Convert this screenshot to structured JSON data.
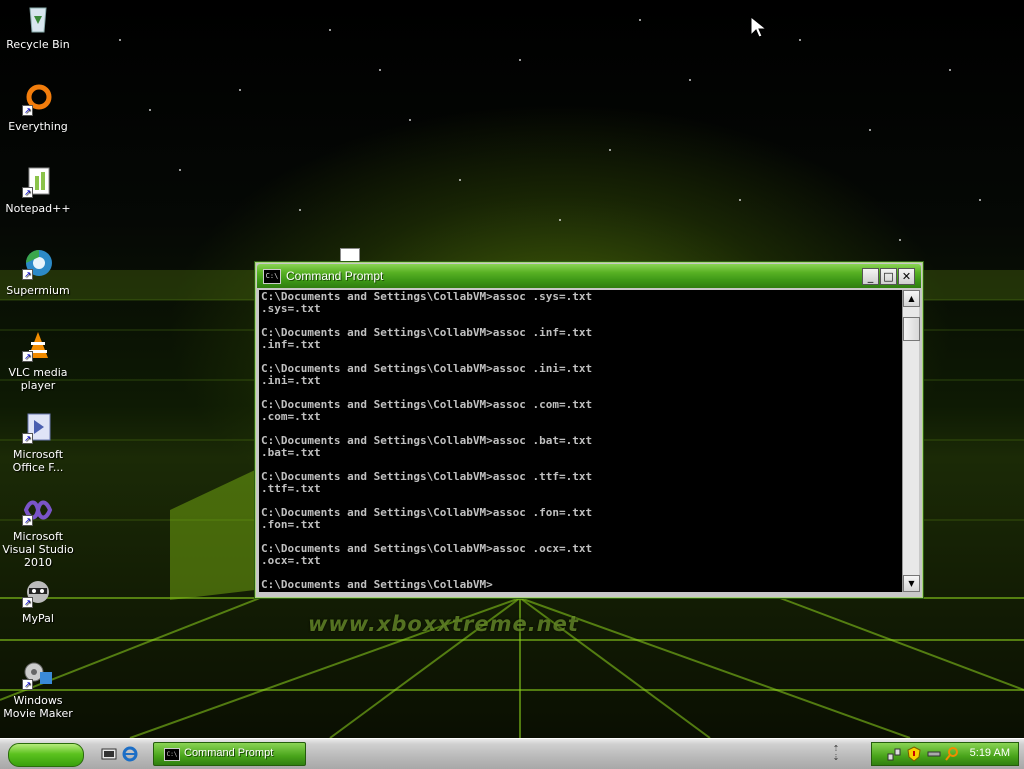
{
  "desktop": {
    "watermark": "www.xboxxtreme.net",
    "icons": [
      {
        "label": "Recycle Bin"
      },
      {
        "label": "Everything"
      },
      {
        "label": "Notepad++"
      },
      {
        "label": "Supermium"
      },
      {
        "label": "VLC media player"
      },
      {
        "label": "Microsoft Office F..."
      },
      {
        "label": "Microsoft Visual Studio 2010"
      },
      {
        "label": "MyPal"
      },
      {
        "label": "Windows Movie Maker"
      }
    ]
  },
  "window": {
    "title": "Command Prompt",
    "icon_text": "C:\\",
    "buttons": {
      "minimize": "_",
      "maximize": "□",
      "close": "✕"
    },
    "console_lines": [
      "C:\\Documents and Settings\\CollabVM>assoc .sys=.txt",
      ".sys=.txt",
      "",
      "C:\\Documents and Settings\\CollabVM>assoc .inf=.txt",
      ".inf=.txt",
      "",
      "C:\\Documents and Settings\\CollabVM>assoc .ini=.txt",
      ".ini=.txt",
      "",
      "C:\\Documents and Settings\\CollabVM>assoc .com=.txt",
      ".com=.txt",
      "",
      "C:\\Documents and Settings\\CollabVM>assoc .bat=.txt",
      ".bat=.txt",
      "",
      "C:\\Documents and Settings\\CollabVM>assoc .ttf=.txt",
      ".ttf=.txt",
      "",
      "C:\\Documents and Settings\\CollabVM>assoc .fon=.txt",
      ".fon=.txt",
      "",
      "C:\\Documents and Settings\\CollabVM>assoc .ocx=.txt",
      ".ocx=.txt",
      "",
      "C:\\Documents and Settings\\CollabVM>"
    ],
    "scroll_up": "▲",
    "scroll_down": "▼"
  },
  "taskbar": {
    "task_label": "Command Prompt",
    "task_icon_text": "C:\\",
    "clock": "5:19 AM"
  },
  "colors": {
    "titlebar": "#4aa51a",
    "console_bg": "#000000",
    "console_text": "#c0c0c0"
  }
}
